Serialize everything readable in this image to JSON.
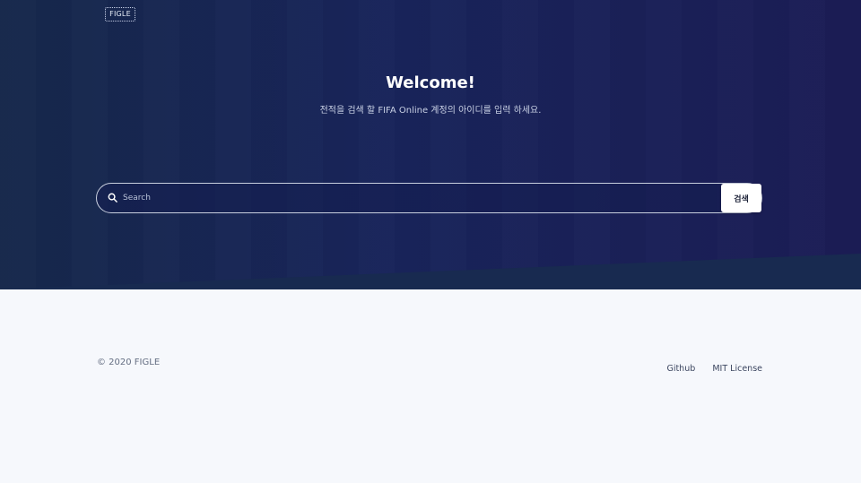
{
  "brand": {
    "logo_text": "FIGLE"
  },
  "hero": {
    "title": "Welcome!",
    "subtitle": "전적을 검색 할 FIFA Online 계정의 아이디를 입력 하세요."
  },
  "search": {
    "icon": "search-icon",
    "placeholder": "Search",
    "value": "",
    "button_label": "검색"
  },
  "footer": {
    "copyright": "© 2020 FIGLE",
    "links": [
      "Github",
      "MIT License"
    ]
  },
  "colors": {
    "hero_bg": "#18245a",
    "footer_bg": "#f6f8fc",
    "accent": "#ffffff"
  }
}
